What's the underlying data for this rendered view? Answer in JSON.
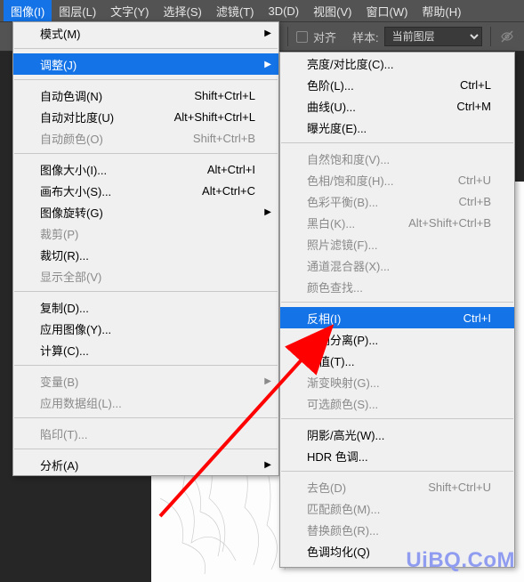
{
  "menubar": {
    "items": [
      "图像(I)",
      "图层(L)",
      "文字(Y)",
      "选择(S)",
      "滤镜(T)",
      "3D(D)",
      "视图(V)",
      "窗口(W)",
      "帮助(H)"
    ],
    "activeIndex": 0
  },
  "toolbar": {
    "align_label": "对齐",
    "sample_label": "样本:",
    "sample_value": "当前图层"
  },
  "main_menu": [
    {
      "label": "模式(M)",
      "arrow": true
    },
    {
      "sep": true
    },
    {
      "label": "调整(J)",
      "arrow": true,
      "highlight": true
    },
    {
      "sep": true
    },
    {
      "label": "自动色调(N)",
      "shortcut": "Shift+Ctrl+L"
    },
    {
      "label": "自动对比度(U)",
      "shortcut": "Alt+Shift+Ctrl+L"
    },
    {
      "label": "自动颜色(O)",
      "shortcut": "Shift+Ctrl+B",
      "disabled": true
    },
    {
      "sep": true
    },
    {
      "label": "图像大小(I)...",
      "shortcut": "Alt+Ctrl+I"
    },
    {
      "label": "画布大小(S)...",
      "shortcut": "Alt+Ctrl+C"
    },
    {
      "label": "图像旋转(G)",
      "arrow": true
    },
    {
      "label": "裁剪(P)",
      "disabled": true
    },
    {
      "label": "裁切(R)..."
    },
    {
      "label": "显示全部(V)",
      "disabled": true
    },
    {
      "sep": true
    },
    {
      "label": "复制(D)..."
    },
    {
      "label": "应用图像(Y)..."
    },
    {
      "label": "计算(C)..."
    },
    {
      "sep": true
    },
    {
      "label": "变量(B)",
      "arrow": true,
      "disabled": true
    },
    {
      "label": "应用数据组(L)...",
      "disabled": true
    },
    {
      "sep": true
    },
    {
      "label": "陷印(T)...",
      "disabled": true
    },
    {
      "sep": true
    },
    {
      "label": "分析(A)",
      "arrow": true
    }
  ],
  "sub_menu": [
    {
      "label": "亮度/对比度(C)..."
    },
    {
      "label": "色阶(L)...",
      "shortcut": "Ctrl+L"
    },
    {
      "label": "曲线(U)...",
      "shortcut": "Ctrl+M"
    },
    {
      "label": "曝光度(E)..."
    },
    {
      "sep": true
    },
    {
      "label": "自然饱和度(V)...",
      "disabled": true
    },
    {
      "label": "色相/饱和度(H)...",
      "shortcut": "Ctrl+U",
      "disabled": true
    },
    {
      "label": "色彩平衡(B)...",
      "shortcut": "Ctrl+B",
      "disabled": true
    },
    {
      "label": "黑白(K)...",
      "shortcut": "Alt+Shift+Ctrl+B",
      "disabled": true
    },
    {
      "label": "照片滤镜(F)...",
      "disabled": true
    },
    {
      "label": "通道混合器(X)...",
      "disabled": true
    },
    {
      "label": "颜色查找...",
      "disabled": true
    },
    {
      "sep": true
    },
    {
      "label": "反相(I)",
      "shortcut": "Ctrl+I",
      "highlight": true
    },
    {
      "label": "色调分离(P)..."
    },
    {
      "label": "阈值(T)..."
    },
    {
      "label": "渐变映射(G)...",
      "disabled": true
    },
    {
      "label": "可选颜色(S)...",
      "disabled": true
    },
    {
      "sep": true
    },
    {
      "label": "阴影/高光(W)..."
    },
    {
      "label": "HDR 色调..."
    },
    {
      "sep": true
    },
    {
      "label": "去色(D)",
      "shortcut": "Shift+Ctrl+U",
      "disabled": true
    },
    {
      "label": "匹配颜色(M)...",
      "disabled": true
    },
    {
      "label": "替换颜色(R)...",
      "disabled": true
    },
    {
      "label": "色调均化(Q)"
    }
  ],
  "watermark": {
    "text": "UiBQ.CoM"
  }
}
